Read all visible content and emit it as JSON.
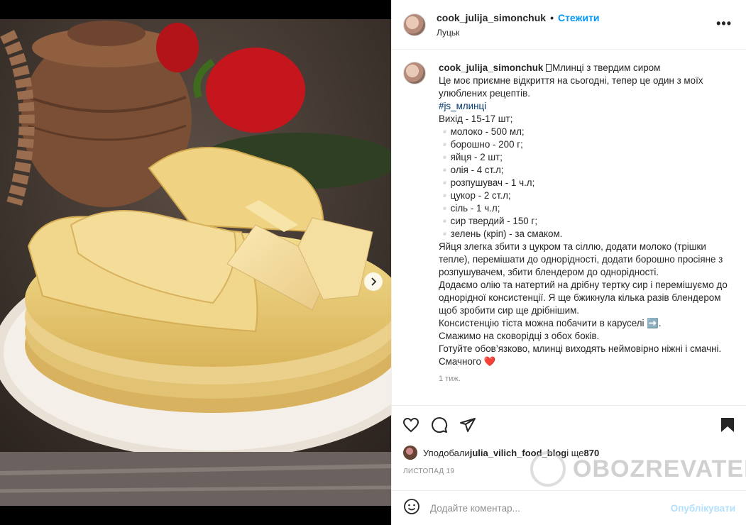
{
  "post": {
    "username": "cook_julija_simonchuk",
    "follow_label": "Стежити",
    "separator": "•",
    "location": "Луцьк",
    "more_label": "•••"
  },
  "caption": {
    "username": "cook_julija_simonchuk",
    "title": "\u0000Млинці з твердим сиром",
    "lines_before_tag": "Це моє приємне відкриття на сьогодні, тепер це один з моїх улюблених рецептів.",
    "hashtag": "#js_млинці",
    "body": "Вихід - 15-17 шт;\n▫️молоко - 500 мл;\n▫️борошно - 200 г;\n▫️яйця - 2 шт;\n▫️олія - 4 ст.л;\n▫️розпушувач - 1 ч.л;\n▫️цукор - 2 ст.л;\n▫️сіль - 1 ч.л;\n▫️сир твердий - 150 г;\n▫️зелень (кріп) - за смаком.\nЯйця злегка збити з цукром та сіллю, додати молоко (трішки тепле), перемішати до однорідності, додати борошно просіяне з розпушувачем, збити блендером до однорідності.\nДодаємо олію та натертий на дрібну тертку сир і перемішуємо до однорідної консистенції. Я ще бжикнула кілька разів блендером щоб зробити сир ще дрібнішим.\nКонсистенцію тіста можна побачити в каруселі ➡️.\nСмажимо на сковорідці з обох боків.\nГотуйте обов’язково, млинці виходять неймовірно ніжні і смачні.\nСмачного ❤️",
    "time_ago": "1 тиж."
  },
  "likes": {
    "prefix": "Уподобали ",
    "user": "julia_vilich_food_blog",
    "middle": " і ще ",
    "count": "870"
  },
  "post_date": "ЛИСТОПАД 19",
  "watermark": "OBOZREVATEL",
  "comment": {
    "placeholder": "Додайте коментар...",
    "publish_label": "Опублікувати"
  },
  "carousel": {
    "total": 2,
    "active": 0
  },
  "colors": {
    "accent": "#0095f6",
    "publish_disabled": "#b2dffc",
    "hashtag": "#00376b"
  },
  "icons": [
    "heart-icon",
    "comment-icon",
    "share-icon",
    "bookmark-icon",
    "emoji-icon",
    "carousel-next-icon",
    "more-icon"
  ]
}
